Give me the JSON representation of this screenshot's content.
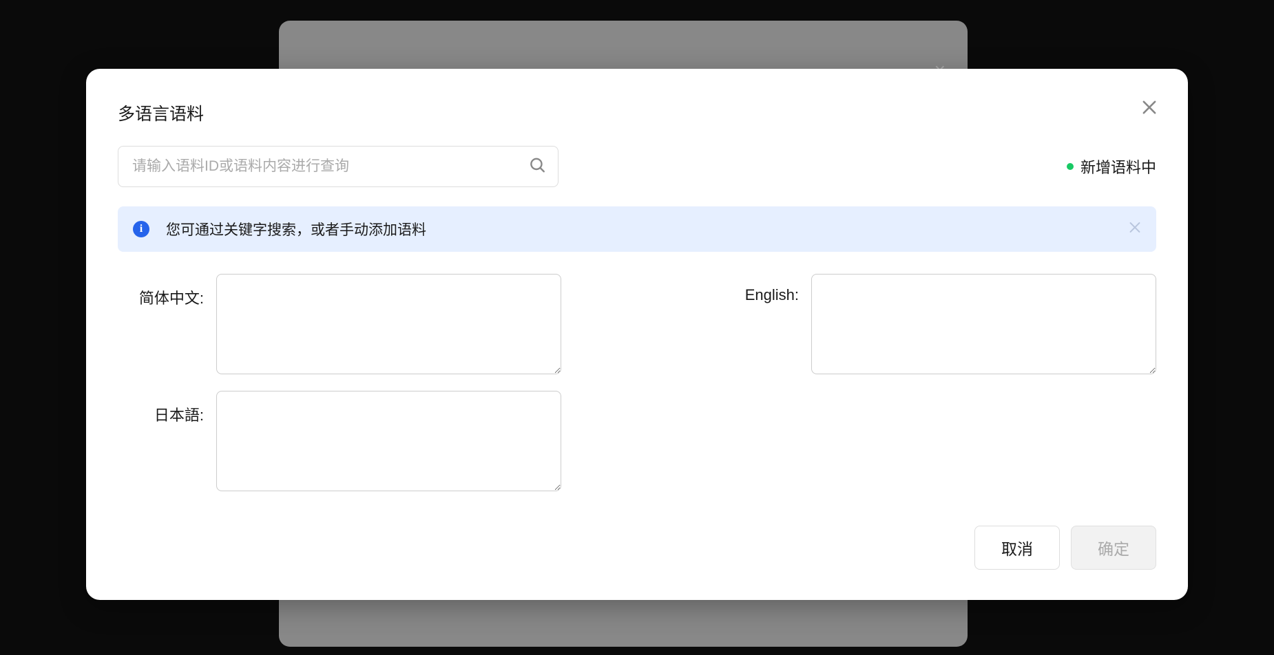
{
  "modal": {
    "title": "多语言语料",
    "search_placeholder": "请输入语料ID或语料内容进行查询",
    "status_text": "新增语料中",
    "info_text": "您可通过关键字搜索，或者手动添加语料",
    "labels": {
      "chinese": "简体中文:",
      "english": "English:",
      "japanese": "日本語:"
    },
    "inputs": {
      "chinese": "",
      "english": "",
      "japanese": ""
    },
    "footer": {
      "cancel": "取消",
      "confirm": "确定"
    }
  }
}
